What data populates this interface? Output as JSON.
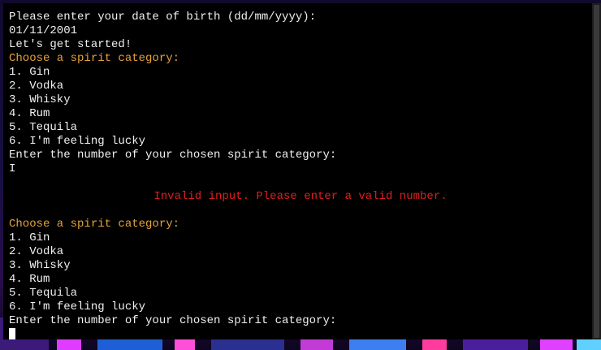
{
  "terminal": {
    "lines": [
      {
        "text": "Please enter your date of birth (dd/mm/yyyy):",
        "style": "normal"
      },
      {
        "text": "01/11/2001",
        "style": "normal"
      },
      {
        "text": "Let's get started!",
        "style": "normal"
      },
      {
        "text": "Choose a spirit category:",
        "style": "heading"
      },
      {
        "text": "1. Gin",
        "style": "normal"
      },
      {
        "text": "2. Vodka",
        "style": "normal"
      },
      {
        "text": "3. Whisky",
        "style": "normal"
      },
      {
        "text": "4. Rum",
        "style": "normal"
      },
      {
        "text": "5. Tequila",
        "style": "normal"
      },
      {
        "text": "6. I'm feeling lucky",
        "style": "normal"
      },
      {
        "text": "Enter the number of your chosen spirit category:",
        "style": "normal"
      },
      {
        "text": "I",
        "style": "normal"
      },
      {
        "text": "",
        "style": "normal"
      },
      {
        "text": "Invalid input. Please enter a valid number.",
        "style": "error"
      },
      {
        "text": "",
        "style": "normal"
      },
      {
        "text": "Choose a spirit category:",
        "style": "heading"
      },
      {
        "text": "1. Gin",
        "style": "normal"
      },
      {
        "text": "2. Vodka",
        "style": "normal"
      },
      {
        "text": "3. Whisky",
        "style": "normal"
      },
      {
        "text": "4. Rum",
        "style": "normal"
      },
      {
        "text": "5. Tequila",
        "style": "normal"
      },
      {
        "text": "6. I'm feeling lucky",
        "style": "normal"
      },
      {
        "text": "Enter the number of your chosen spirit category:",
        "style": "normal"
      }
    ],
    "current_input": ""
  },
  "colors": {
    "text": "#f0f0f0",
    "heading": "#e6a23c",
    "error": "#e01e1e",
    "background": "#000000"
  }
}
